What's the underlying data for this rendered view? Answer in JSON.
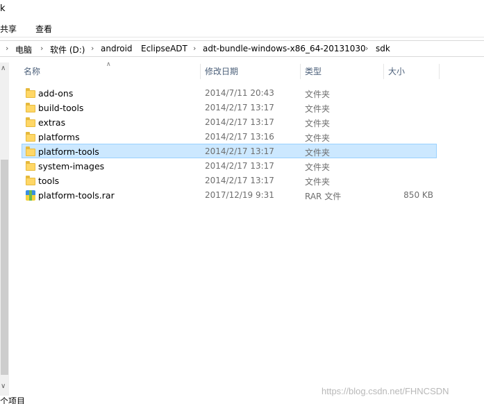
{
  "window": {
    "title_fragment": "k"
  },
  "ribbon": {
    "tabs": [
      "共享",
      "查看"
    ]
  },
  "address": {
    "crumbs": [
      "电脑",
      "软件 (D:)",
      "android",
      "EclipseADT",
      "adt-bundle-windows-x86_64-20131030",
      "sdk"
    ]
  },
  "columns": {
    "name": "名称",
    "date": "修改日期",
    "type": "类型",
    "size": "大小"
  },
  "files": [
    {
      "name": "add-ons",
      "date": "2014/7/11 20:43",
      "type": "文件夹",
      "size": "",
      "icon": "folder-icon",
      "selected": false
    },
    {
      "name": "build-tools",
      "date": "2014/2/17 13:17",
      "type": "文件夹",
      "size": "",
      "icon": "folder-icon",
      "selected": false
    },
    {
      "name": "extras",
      "date": "2014/2/17 13:17",
      "type": "文件夹",
      "size": "",
      "icon": "folder-icon",
      "selected": false
    },
    {
      "name": "platforms",
      "date": "2014/2/17 13:16",
      "type": "文件夹",
      "size": "",
      "icon": "folder-icon",
      "selected": false
    },
    {
      "name": "platform-tools",
      "date": "2014/2/17 13:17",
      "type": "文件夹",
      "size": "",
      "icon": "folder-icon",
      "selected": true
    },
    {
      "name": "system-images",
      "date": "2014/2/17 13:17",
      "type": "文件夹",
      "size": "",
      "icon": "folder-icon",
      "selected": false
    },
    {
      "name": "tools",
      "date": "2014/2/17 13:17",
      "type": "文件夹",
      "size": "",
      "icon": "folder-icon",
      "selected": false
    },
    {
      "name": "platform-tools.rar",
      "date": "2017/12/19 9:31",
      "type": "RAR 文件",
      "size": "850 KB",
      "icon": "rar-archive-icon",
      "selected": false
    }
  ],
  "status": {
    "item_count_fragment": "个项目"
  },
  "watermark": "https://blog.csdn.net/FHNCSDN",
  "colors": {
    "selection_bg": "#cce8ff",
    "selection_border": "#99d1ff",
    "folder": "#ffd766",
    "header_text": "#4c607a"
  }
}
